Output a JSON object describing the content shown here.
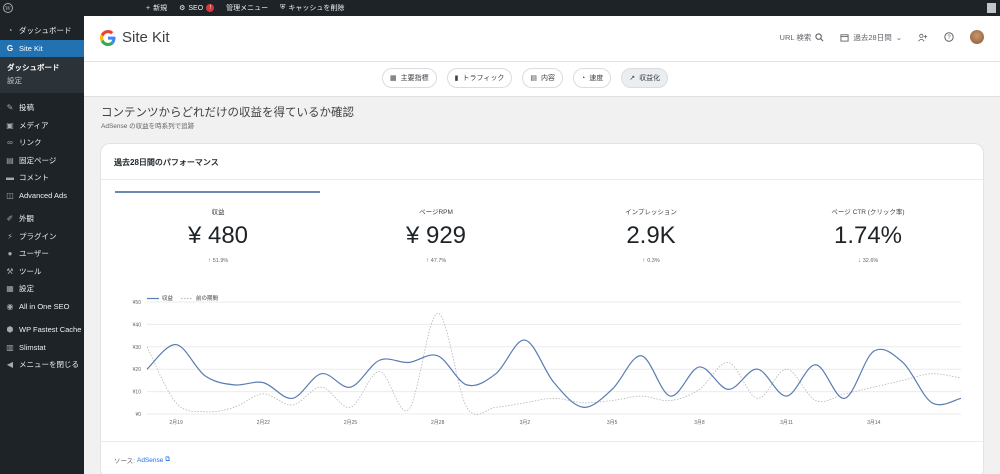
{
  "adminbar": {
    "new_label": "新規",
    "seo_label": "SEO",
    "seo_badge": "!",
    "manage_label": "管理メニュー",
    "cache_label": "キャッシュを削除"
  },
  "sidebar": {
    "items_top": [
      {
        "label": "ダッシュボード",
        "icon": "dashboard-icon"
      },
      {
        "label": "Site Kit",
        "icon": "google-icon",
        "active": true
      }
    ],
    "submenu": [
      {
        "label": "ダッシュボード",
        "current": true
      },
      {
        "label": "設定",
        "current": false
      }
    ],
    "items_mid": [
      {
        "label": "投稿",
        "icon": "pin-icon"
      },
      {
        "label": "メディア",
        "icon": "media-icon"
      },
      {
        "label": "リンク",
        "icon": "link-icon"
      },
      {
        "label": "固定ページ",
        "icon": "page-icon"
      },
      {
        "label": "コメント",
        "icon": "comment-icon"
      },
      {
        "label": "Advanced Ads",
        "icon": "ads-icon"
      }
    ],
    "items_bottom": [
      {
        "label": "外観",
        "icon": "brush-icon"
      },
      {
        "label": "プラグイン",
        "icon": "plugin-icon"
      },
      {
        "label": "ユーザー",
        "icon": "user-icon"
      },
      {
        "label": "ツール",
        "icon": "wrench-icon"
      },
      {
        "label": "設定",
        "icon": "settings-icon"
      },
      {
        "label": "All in One SEO",
        "icon": "aioseo-icon"
      }
    ],
    "items_extra": [
      {
        "label": "WP Fastest Cache",
        "icon": "cache-icon"
      },
      {
        "label": "Slimstat",
        "icon": "chart-icon"
      },
      {
        "label": "メニューを閉じる",
        "icon": "collapse-icon"
      }
    ]
  },
  "header": {
    "brand": "Site Kit",
    "url_search": "URL 検索",
    "date_range": "過去28日間"
  },
  "nav": {
    "chips": [
      {
        "label": "主要指標",
        "icon": "grid-icon",
        "active": false
      },
      {
        "label": "トラフィック",
        "icon": "bar-chart-icon",
        "active": false
      },
      {
        "label": "内容",
        "icon": "content-icon",
        "active": false
      },
      {
        "label": "速度",
        "icon": "speed-icon",
        "active": false
      },
      {
        "label": "収益化",
        "icon": "trend-icon",
        "active": true
      }
    ]
  },
  "page": {
    "title": "コンテンツからどれだけの収益を得ているか確認",
    "subtitle": "AdSense の収益を時系列で追跡"
  },
  "card": {
    "title": "過去28日間のパフォーマンス",
    "metrics": [
      {
        "label": "収益",
        "value": "¥ 480",
        "change": "51.9%",
        "direction": "up"
      },
      {
        "label": "ページRPM",
        "value": "¥ 929",
        "change": "47.7%",
        "direction": "up"
      },
      {
        "label": "インプレッション",
        "value": "2.9K",
        "change": "0.3%",
        "direction": "up"
      },
      {
        "label": "ページ CTR (クリック率)",
        "value": "1.74%",
        "change": "32.6%",
        "direction": "down"
      }
    ],
    "legend": {
      "current": "収益",
      "previous": "前の期間"
    },
    "source_label": "ソース:",
    "source_link": "AdSense"
  },
  "chart_data": {
    "type": "line",
    "y_tick_labels": [
      "¥0",
      "¥10",
      "¥20",
      "¥30",
      "¥40",
      "¥50"
    ],
    "ylim": [
      0,
      50
    ],
    "x_tick_labels": [
      "2月19",
      "2月22",
      "2月25",
      "2月28",
      "3月2",
      "3月5",
      "3月8",
      "3月11",
      "3月14"
    ],
    "x_tick_days": [
      1,
      4,
      7,
      10,
      13,
      16,
      19,
      22,
      25
    ],
    "series": [
      {
        "name": "収益",
        "color": "#5a7cb2",
        "days": [
          0,
          1,
          2,
          3,
          4,
          5,
          6,
          7,
          8,
          9,
          10,
          11,
          12,
          13,
          14,
          15,
          16,
          17,
          18,
          19,
          20,
          21,
          22,
          23,
          24,
          25,
          26,
          27,
          28
        ],
        "values": [
          20,
          31,
          17,
          13,
          14,
          7,
          18,
          12,
          24,
          23,
          26,
          13,
          18,
          33,
          14,
          3,
          11,
          26,
          8,
          21,
          11,
          20,
          8,
          22,
          7,
          28,
          23,
          5,
          7
        ]
      },
      {
        "name": "前の期間",
        "color": "#b5b5b5",
        "days": [
          0,
          1,
          2,
          3,
          4,
          5,
          6,
          7,
          8,
          9,
          10,
          11,
          12,
          13,
          14,
          15,
          16,
          17,
          18,
          19,
          20,
          21,
          22,
          23,
          24,
          25,
          26,
          27,
          28
        ],
        "values": [
          30,
          5,
          1,
          3,
          9,
          4,
          12,
          3,
          19,
          2,
          45,
          3,
          3,
          5,
          7,
          5,
          6,
          8,
          6,
          11,
          23,
          7,
          20,
          6,
          9,
          12,
          15,
          18,
          16
        ]
      }
    ]
  }
}
